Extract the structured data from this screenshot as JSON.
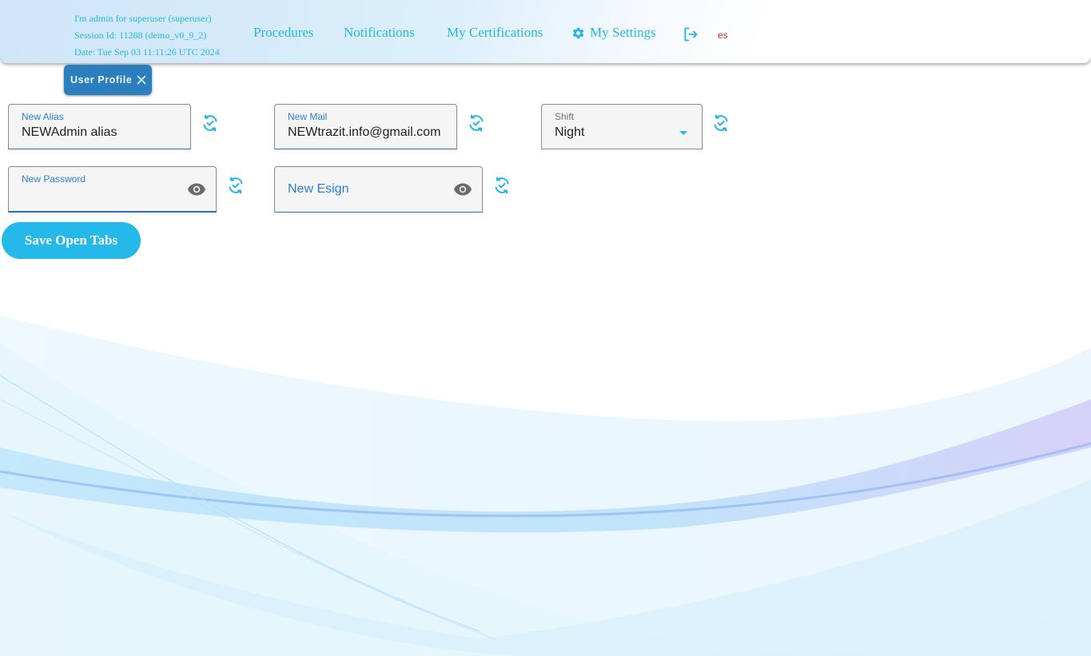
{
  "header": {
    "user_line": "I'm admin for superuser (superuser)",
    "session_line": "Session Id: 11288 (demo_v0_9_2)",
    "date_line": "Date: Tue Sep 03 11:11:26 UTC 2024",
    "nav": {
      "procedures": "Procedures",
      "notifications": "Notifications",
      "certifications": "My Certifications",
      "settings": "My Settings"
    },
    "language": "es"
  },
  "tab": {
    "label": "User Profile"
  },
  "form": {
    "alias": {
      "label": "New Alias",
      "value": "NEWAdmin alias"
    },
    "mail": {
      "label": "New Mail",
      "value": "NEWtrazit.info@gmail.com"
    },
    "shift": {
      "label": "Shift",
      "value": "Night"
    },
    "password": {
      "label": "New Password",
      "value": ""
    },
    "esign": {
      "placeholder": "New Esign"
    }
  },
  "actions": {
    "save_open_tabs": "Save Open Tabs"
  },
  "icons": {
    "settings": "gear-icon",
    "logout": "logout-icon",
    "close": "close-icon",
    "refresh": "refresh-check-icon",
    "visibility": "eye-icon",
    "dropdown": "caret-down-icon"
  },
  "colors": {
    "accent": "#24b6e6",
    "tab": "#2b7fbf",
    "field_label": "#2a7fd4",
    "language": "#c0392b",
    "button": "#24b9e9"
  }
}
